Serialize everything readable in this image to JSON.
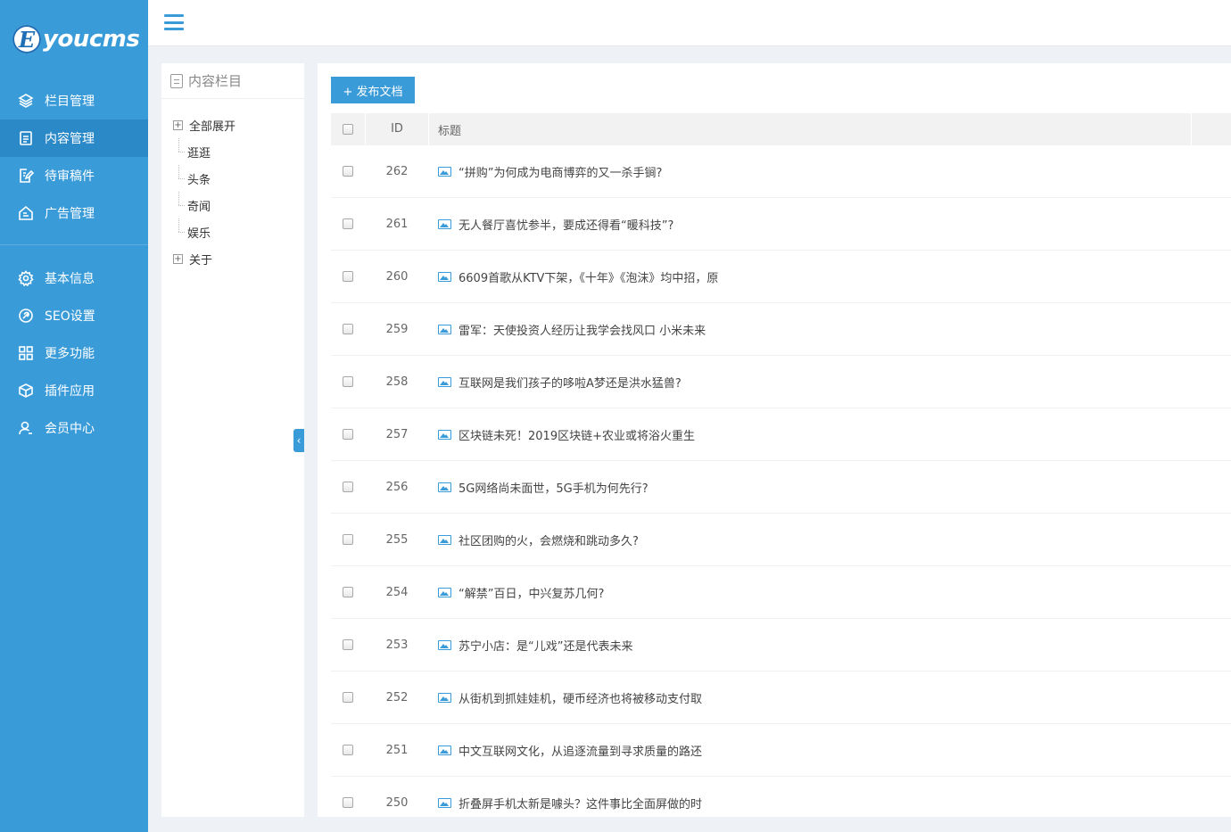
{
  "brand": {
    "logo_letter": "E",
    "logo_text": "youcms"
  },
  "sidebar": {
    "items": [
      {
        "label": "栏目管理",
        "icon": "layers-icon"
      },
      {
        "label": "内容管理",
        "icon": "document-icon",
        "active": true
      },
      {
        "label": "待审稿件",
        "icon": "edit-icon"
      },
      {
        "label": "广告管理",
        "icon": "ad-icon"
      }
    ],
    "items2": [
      {
        "label": "基本信息",
        "icon": "gear-icon"
      },
      {
        "label": "SEO设置",
        "icon": "link-icon"
      },
      {
        "label": "更多功能",
        "icon": "grid-icon"
      },
      {
        "label": "插件应用",
        "icon": "cube-icon"
      },
      {
        "label": "会员中心",
        "icon": "user-icon"
      }
    ]
  },
  "tree": {
    "title": "内容栏目",
    "expand_all": "全部展开",
    "children": [
      "逛逛",
      "头条",
      "奇闻",
      "娱乐"
    ],
    "about": "关于"
  },
  "main": {
    "publish_label": "+ 发布文档",
    "columns": {
      "id": "ID",
      "title": "标题"
    },
    "rows": [
      {
        "id": "262",
        "title": "“拼购”为何成为电商博弈的又一杀手锏?"
      },
      {
        "id": "261",
        "title": "无人餐厅喜忧参半，要成还得看“暖科技”?"
      },
      {
        "id": "260",
        "title": "6609首歌从KTV下架，《十年》《泡沫》均中招，原"
      },
      {
        "id": "259",
        "title": "雷军：天使投资人经历让我学会找风口 小米未来"
      },
      {
        "id": "258",
        "title": "互联网是我们孩子的哆啦A梦还是洪水猛兽?"
      },
      {
        "id": "257",
        "title": "区块链未死！2019区块链+农业或将浴火重生"
      },
      {
        "id": "256",
        "title": "5G网络尚未面世，5G手机为何先行?"
      },
      {
        "id": "255",
        "title": "社区团购的火，会燃烧和跳动多久?"
      },
      {
        "id": "254",
        "title": "“解禁”百日，中兴复苏几何?"
      },
      {
        "id": "253",
        "title": "苏宁小店：是“儿戏”还是代表未来"
      },
      {
        "id": "252",
        "title": "从街机到抓娃娃机，硬币经济也将被移动支付取"
      },
      {
        "id": "251",
        "title": "中文互联网文化，从追逐流量到寻求质量的路还"
      },
      {
        "id": "250",
        "title": "折叠屏手机太新是噱头？这件事比全面屏做的时"
      }
    ]
  }
}
